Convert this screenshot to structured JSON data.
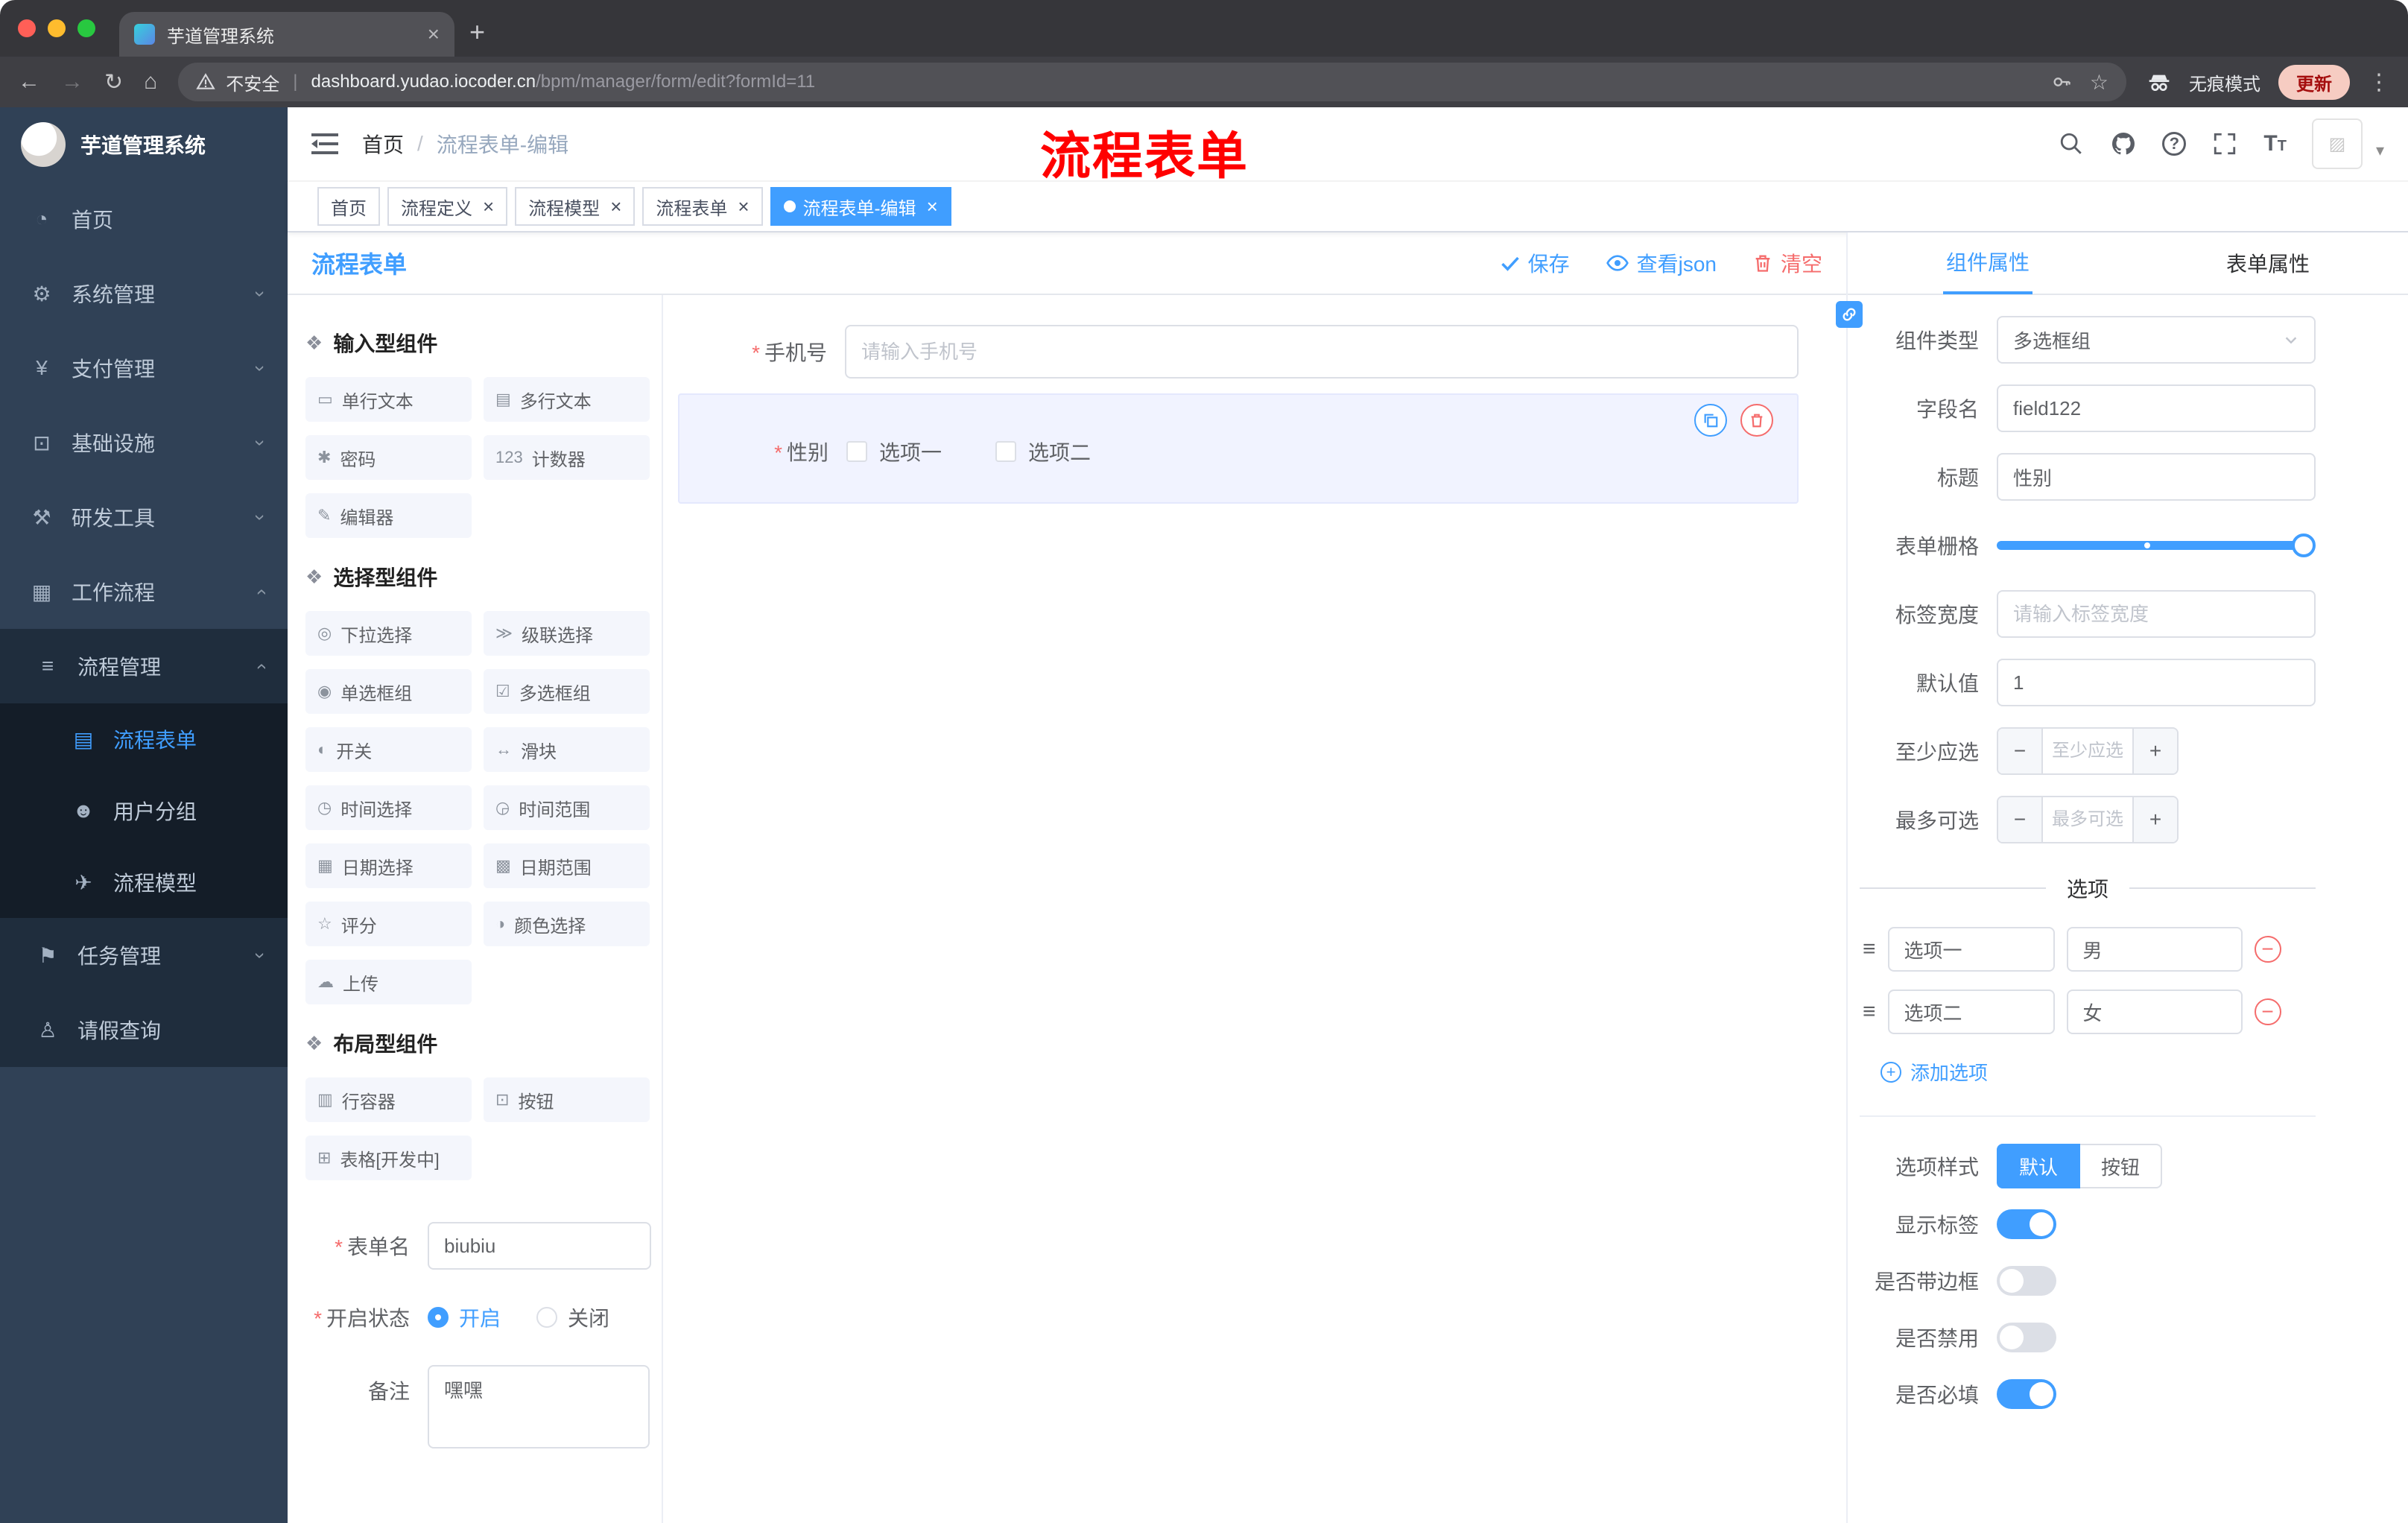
{
  "browser": {
    "tab_title": "芋道管理系统",
    "security_label": "不安全",
    "url_host": "dashboard.yudao.iocoder.cn",
    "url_path": "/bpm/manager/form/edit?formId=11",
    "incognito_label": "无痕模式",
    "update_label": "更新"
  },
  "sidebar": {
    "logo_title": "芋道管理系统",
    "menu": [
      {
        "key": "home",
        "icon": "dashboard",
        "label": "首页",
        "level": 1
      },
      {
        "key": "system",
        "icon": "gear",
        "label": "系统管理",
        "level": 1,
        "chevron": "down"
      },
      {
        "key": "payment",
        "icon": "yen",
        "label": "支付管理",
        "level": 1,
        "chevron": "down"
      },
      {
        "key": "infrastructure",
        "icon": "monitor",
        "label": "基础设施",
        "level": 1,
        "chevron": "down"
      },
      {
        "key": "devtools",
        "icon": "tools",
        "label": "研发工具",
        "level": 1,
        "chevron": "down"
      },
      {
        "key": "workflow",
        "icon": "grid",
        "label": "工作流程",
        "level": 1,
        "chevron": "up"
      },
      {
        "key": "process-manage",
        "icon": "list",
        "label": "流程管理",
        "level": 2,
        "chevron": "up"
      },
      {
        "key": "process-form",
        "icon": "document",
        "label": "流程表单",
        "level": 3,
        "active": true
      },
      {
        "key": "user-group",
        "icon": "users",
        "label": "用户分组",
        "level": 3
      },
      {
        "key": "process-model",
        "icon": "send",
        "label": "流程模型",
        "level": 3
      },
      {
        "key": "task-manage",
        "icon": "flag",
        "label": "任务管理",
        "level": 2,
        "chevron": "down"
      },
      {
        "key": "leave-query",
        "icon": "person",
        "label": "请假查询",
        "level": 2
      }
    ]
  },
  "header": {
    "breadcrumb_home": "首页",
    "breadcrumb_current": "流程表单-编辑",
    "annotation": "流程表单"
  },
  "tags": [
    {
      "label": "首页",
      "closable": false,
      "active": false
    },
    {
      "label": "流程定义",
      "closable": true,
      "active": false
    },
    {
      "label": "流程模型",
      "closable": true,
      "active": false
    },
    {
      "label": "流程表单",
      "closable": true,
      "active": false
    },
    {
      "label": "流程表单-编辑",
      "closable": true,
      "active": true
    }
  ],
  "editor": {
    "title": "流程表单",
    "save_label": "保存",
    "view_json_label": "查看json",
    "clear_label": "清空"
  },
  "palette": {
    "groups": [
      {
        "title": "输入型组件",
        "items": [
          {
            "label": "单行文本",
            "icon": "single-line"
          },
          {
            "label": "多行文本",
            "icon": "multi-line"
          },
          {
            "label": "密码",
            "icon": "password"
          },
          {
            "label": "计数器",
            "icon": "counter"
          },
          {
            "label": "编辑器",
            "icon": "editor"
          }
        ]
      },
      {
        "title": "选择型组件",
        "items": [
          {
            "label": "下拉选择",
            "icon": "select"
          },
          {
            "label": "级联选择",
            "icon": "cascader"
          },
          {
            "label": "单选框组",
            "icon": "radio"
          },
          {
            "label": "多选框组",
            "icon": "checkbox"
          },
          {
            "label": "开关",
            "icon": "switch"
          },
          {
            "label": "滑块",
            "icon": "slider"
          },
          {
            "label": "时间选择",
            "icon": "time"
          },
          {
            "label": "时间范围",
            "icon": "time-range"
          },
          {
            "label": "日期选择",
            "icon": "date"
          },
          {
            "label": "日期范围",
            "icon": "date-range"
          },
          {
            "label": "评分",
            "icon": "rate"
          },
          {
            "label": "颜色选择",
            "icon": "color"
          },
          {
            "label": "上传",
            "icon": "upload"
          }
        ]
      },
      {
        "title": "布局型组件",
        "items": [
          {
            "label": "行容器",
            "icon": "row"
          },
          {
            "label": "按钮",
            "icon": "button"
          },
          {
            "label": "表格[开发中]",
            "icon": "table"
          }
        ]
      }
    ]
  },
  "meta": {
    "form_name_label": "表单名",
    "form_name_value": "biubiu",
    "status_label": "开启状态",
    "status_on": "开启",
    "status_off": "关闭",
    "remark_label": "备注",
    "remark_value": "嘿嘿"
  },
  "canvas": {
    "phone_label": "手机号",
    "phone_placeholder": "请输入手机号",
    "gender_label": "性别",
    "gender_options": [
      "选项一",
      "选项二"
    ]
  },
  "panel": {
    "tab_component": "组件属性",
    "tab_form": "表单属性",
    "component_type_label": "组件类型",
    "component_type_value": "多选框组",
    "field_name_label": "字段名",
    "field_name_value": "field122",
    "title_label": "标题",
    "title_value": "性别",
    "grid_label": "表单栅格",
    "label_width_label": "标签宽度",
    "label_width_placeholder": "请输入标签宽度",
    "default_label": "默认值",
    "default_value": "1",
    "min_label": "至少应选",
    "min_placeholder": "至少应选",
    "max_label": "最多可选",
    "max_placeholder": "最多可选",
    "options_title": "选项",
    "options": [
      {
        "label": "选项一",
        "value": "男"
      },
      {
        "label": "选项二",
        "value": "女"
      }
    ],
    "add_option_label": "添加选项",
    "option_style_label": "选项样式",
    "style_default": "默认",
    "style_button": "按钮",
    "toggles": [
      {
        "label": "显示标签",
        "on": true
      },
      {
        "label": "是否带边框",
        "on": false
      },
      {
        "label": "是否禁用",
        "on": false
      },
      {
        "label": "是否必填",
        "on": true
      }
    ]
  },
  "colors": {
    "accent": "#409eff",
    "danger": "#f56c6c",
    "sidebar_bg": "#304156",
    "submenu_bg": "#1f2d3d",
    "active_tag_bg": "#409eff"
  },
  "icons": {
    "dashboard": "◔",
    "gear": "⚙",
    "yen": "¥",
    "monitor": "⊡",
    "tools": "⚒",
    "grid": "▦",
    "list": "≡",
    "document": "▤",
    "users": "☻",
    "send": "✈",
    "flag": "⚑",
    "person": "♙",
    "group": "❖",
    "single-line": "▭",
    "multi-line": "▤",
    "password": "✱",
    "counter": "123",
    "editor": "✎",
    "select": "◎",
    "cascader": "≫",
    "radio": "◉",
    "checkbox": "☑",
    "switch": "◐",
    "slider": "↔",
    "time": "◷",
    "time-range": "◶",
    "date": "▦",
    "date-range": "▩",
    "rate": "☆",
    "color": "◑",
    "upload": "☁",
    "row": "▥",
    "button": "⊡",
    "table": "⊞"
  }
}
